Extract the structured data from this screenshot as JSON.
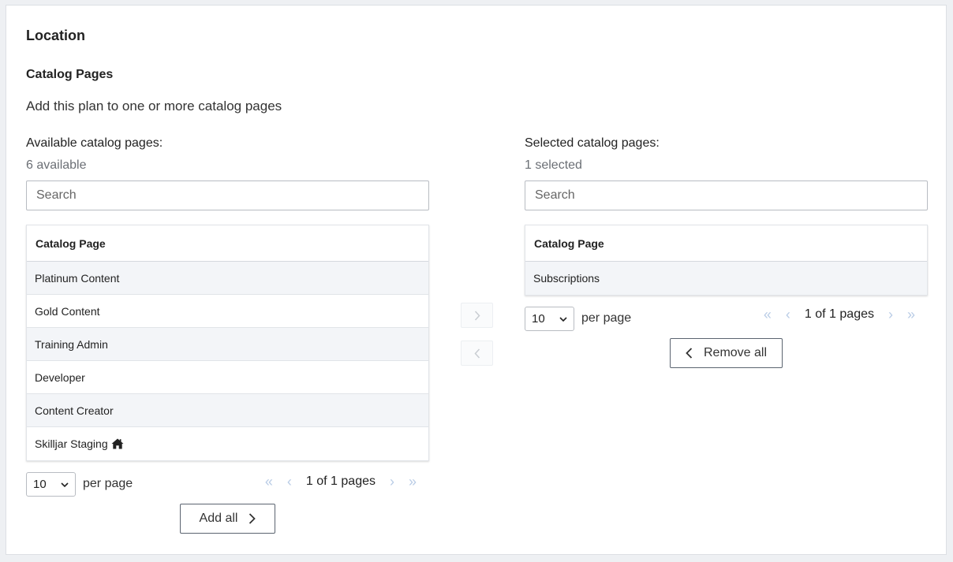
{
  "section": {
    "title": "Location",
    "subtitle": "Catalog Pages",
    "description": "Add this plan to one or more catalog pages"
  },
  "available": {
    "title": "Available catalog pages:",
    "count": "6 available",
    "search_placeholder": "Search",
    "column_header": "Catalog Page",
    "rows": [
      {
        "label": "Platinum Content"
      },
      {
        "label": "Gold Content"
      },
      {
        "label": "Training Admin"
      },
      {
        "label": "Developer"
      },
      {
        "label": "Content Creator"
      },
      {
        "label": "Skilljar Staging",
        "icon": "home-icon"
      }
    ],
    "per_page_value": "10",
    "per_page_label": "per page",
    "page_text": "1 of 1 pages",
    "bulk_button": "Add all"
  },
  "selected": {
    "title": "Selected catalog pages:",
    "count": "1 selected",
    "search_placeholder": "Search",
    "column_header": "Catalog Page",
    "rows": [
      {
        "label": "Subscriptions"
      }
    ],
    "per_page_value": "10",
    "per_page_label": "per page",
    "page_text": "1 of 1 pages",
    "bulk_button": "Remove all"
  },
  "icons": {
    "first": "«",
    "prev": "‹",
    "next": "›",
    "last": "»"
  },
  "colors": {
    "accent_disabled": "#b9cce6",
    "row_alt": "#f3f5f8",
    "border": "#5b6470"
  }
}
